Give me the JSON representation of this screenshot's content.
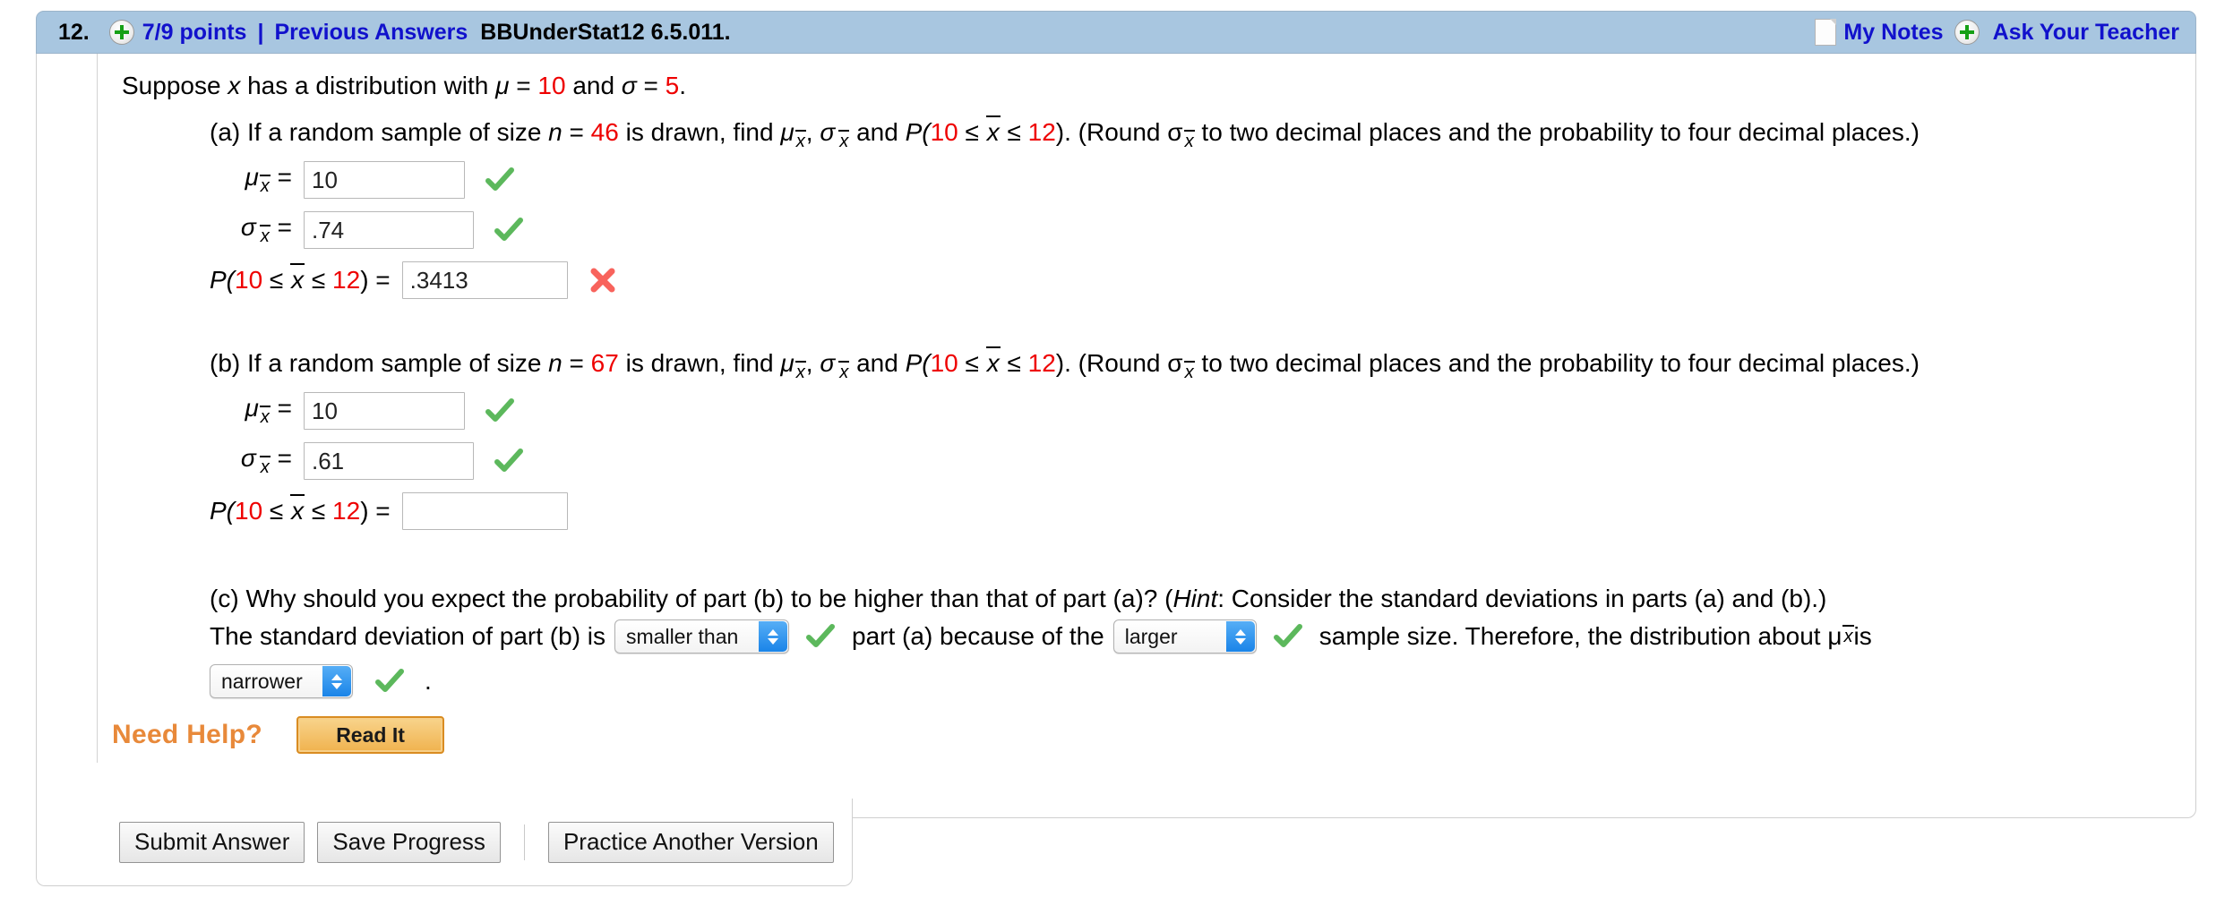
{
  "header": {
    "question_number": "12.",
    "points": "7/9 points",
    "separator": "|",
    "previous_answers": "Previous Answers",
    "assignment_code": "BBUnderStat12 6.5.011.",
    "my_notes": "My Notes",
    "ask_your_teacher": "Ask Your Teacher",
    "plus_icon": "plus-circle-icon",
    "notes_icon": "page-icon",
    "background_color": "#a8c6e0",
    "link_color": "#1111cc"
  },
  "problem": {
    "statement": {
      "pre": "Suppose ",
      "variable": "x",
      "mid": " has a distribution with ",
      "mu_symbol": "μ",
      "eq1": " = ",
      "mu_value": "10",
      "and": " and ",
      "sigma_symbol": "σ",
      "eq2": " = ",
      "sigma_value": "5",
      "period": "."
    },
    "parts": [
      {
        "id": "a",
        "label": "(a)",
        "text_1": "If a random sample of size ",
        "n_symbol": "n",
        "eq": " = ",
        "n_value": "46",
        "text_2": " is drawn, find ",
        "mu_sub": "μ",
        "comma": ", ",
        "sigma_sub": "σ",
        "text_3": " and ",
        "prob_open": "P(",
        "low": "10",
        "le1": " ≤ ",
        "xbar": "x",
        "le2": " ≤ ",
        "high": "12",
        "prob_close": ").",
        "round_note": "(Round σ",
        "round_note_2": " to two decimal places and the probability to four decimal places.)",
        "fields": [
          {
            "name": "mu-xbar",
            "value": "10",
            "status": "correct",
            "status_icon": "green-check-icon"
          },
          {
            "name": "sigma-xbar",
            "value": ".74",
            "status": "correct",
            "status_icon": "green-check-icon"
          },
          {
            "name": "probability",
            "value": ".3413",
            "status": "incorrect",
            "status_icon": "red-x-icon"
          }
        ]
      },
      {
        "id": "b",
        "label": "(b)",
        "text_1": "If a random sample of size ",
        "n_symbol": "n",
        "eq": " = ",
        "n_value": "67",
        "text_2": " is drawn, find ",
        "mu_sub": "μ",
        "comma": ", ",
        "sigma_sub": "σ",
        "text_3": " and ",
        "prob_open": "P(",
        "low": "10",
        "le1": " ≤ ",
        "xbar": "x",
        "le2": " ≤ ",
        "high": "12",
        "prob_close": ").",
        "round_note": "(Round σ",
        "round_note_2": " to two decimal places and the probability to four decimal places.)",
        "fields": [
          {
            "name": "mu-xbar",
            "value": "10",
            "status": "correct",
            "status_icon": "green-check-icon"
          },
          {
            "name": "sigma-xbar",
            "value": ".61",
            "status": "correct",
            "status_icon": "green-check-icon"
          },
          {
            "name": "probability",
            "value": "",
            "status": "empty",
            "status_icon": "none"
          }
        ]
      }
    ],
    "part_c": {
      "label": "(c)",
      "question": "Why should you expect the probability of part (b) to be higher than that of part (a)? (",
      "hint_word": "Hint",
      "hint_rest": ": Consider the standard deviations in parts (a) and (b).)",
      "line2_a": "The standard deviation of part (b) is",
      "select_1": {
        "name": "comparison-select",
        "value": "smaller than",
        "status_icon": "green-check-icon"
      },
      "line2_b": "part (a) because of the",
      "select_2": {
        "name": "sample-size-select",
        "value": "larger",
        "status_icon": "green-check-icon"
      },
      "line2_c": "sample size. Therefore, the distribution about μ",
      "line2_d": " is",
      "select_3": {
        "name": "distribution-shape-select",
        "value": "narrower",
        "status_icon": "green-check-icon"
      },
      "line3_period": "."
    }
  },
  "need_help": {
    "label": "Need Help?",
    "read_it": "Read It",
    "label_color": "#e8893a"
  },
  "buttons": {
    "submit": "Submit Answer",
    "save": "Save Progress",
    "practice": "Practice Another Version"
  }
}
